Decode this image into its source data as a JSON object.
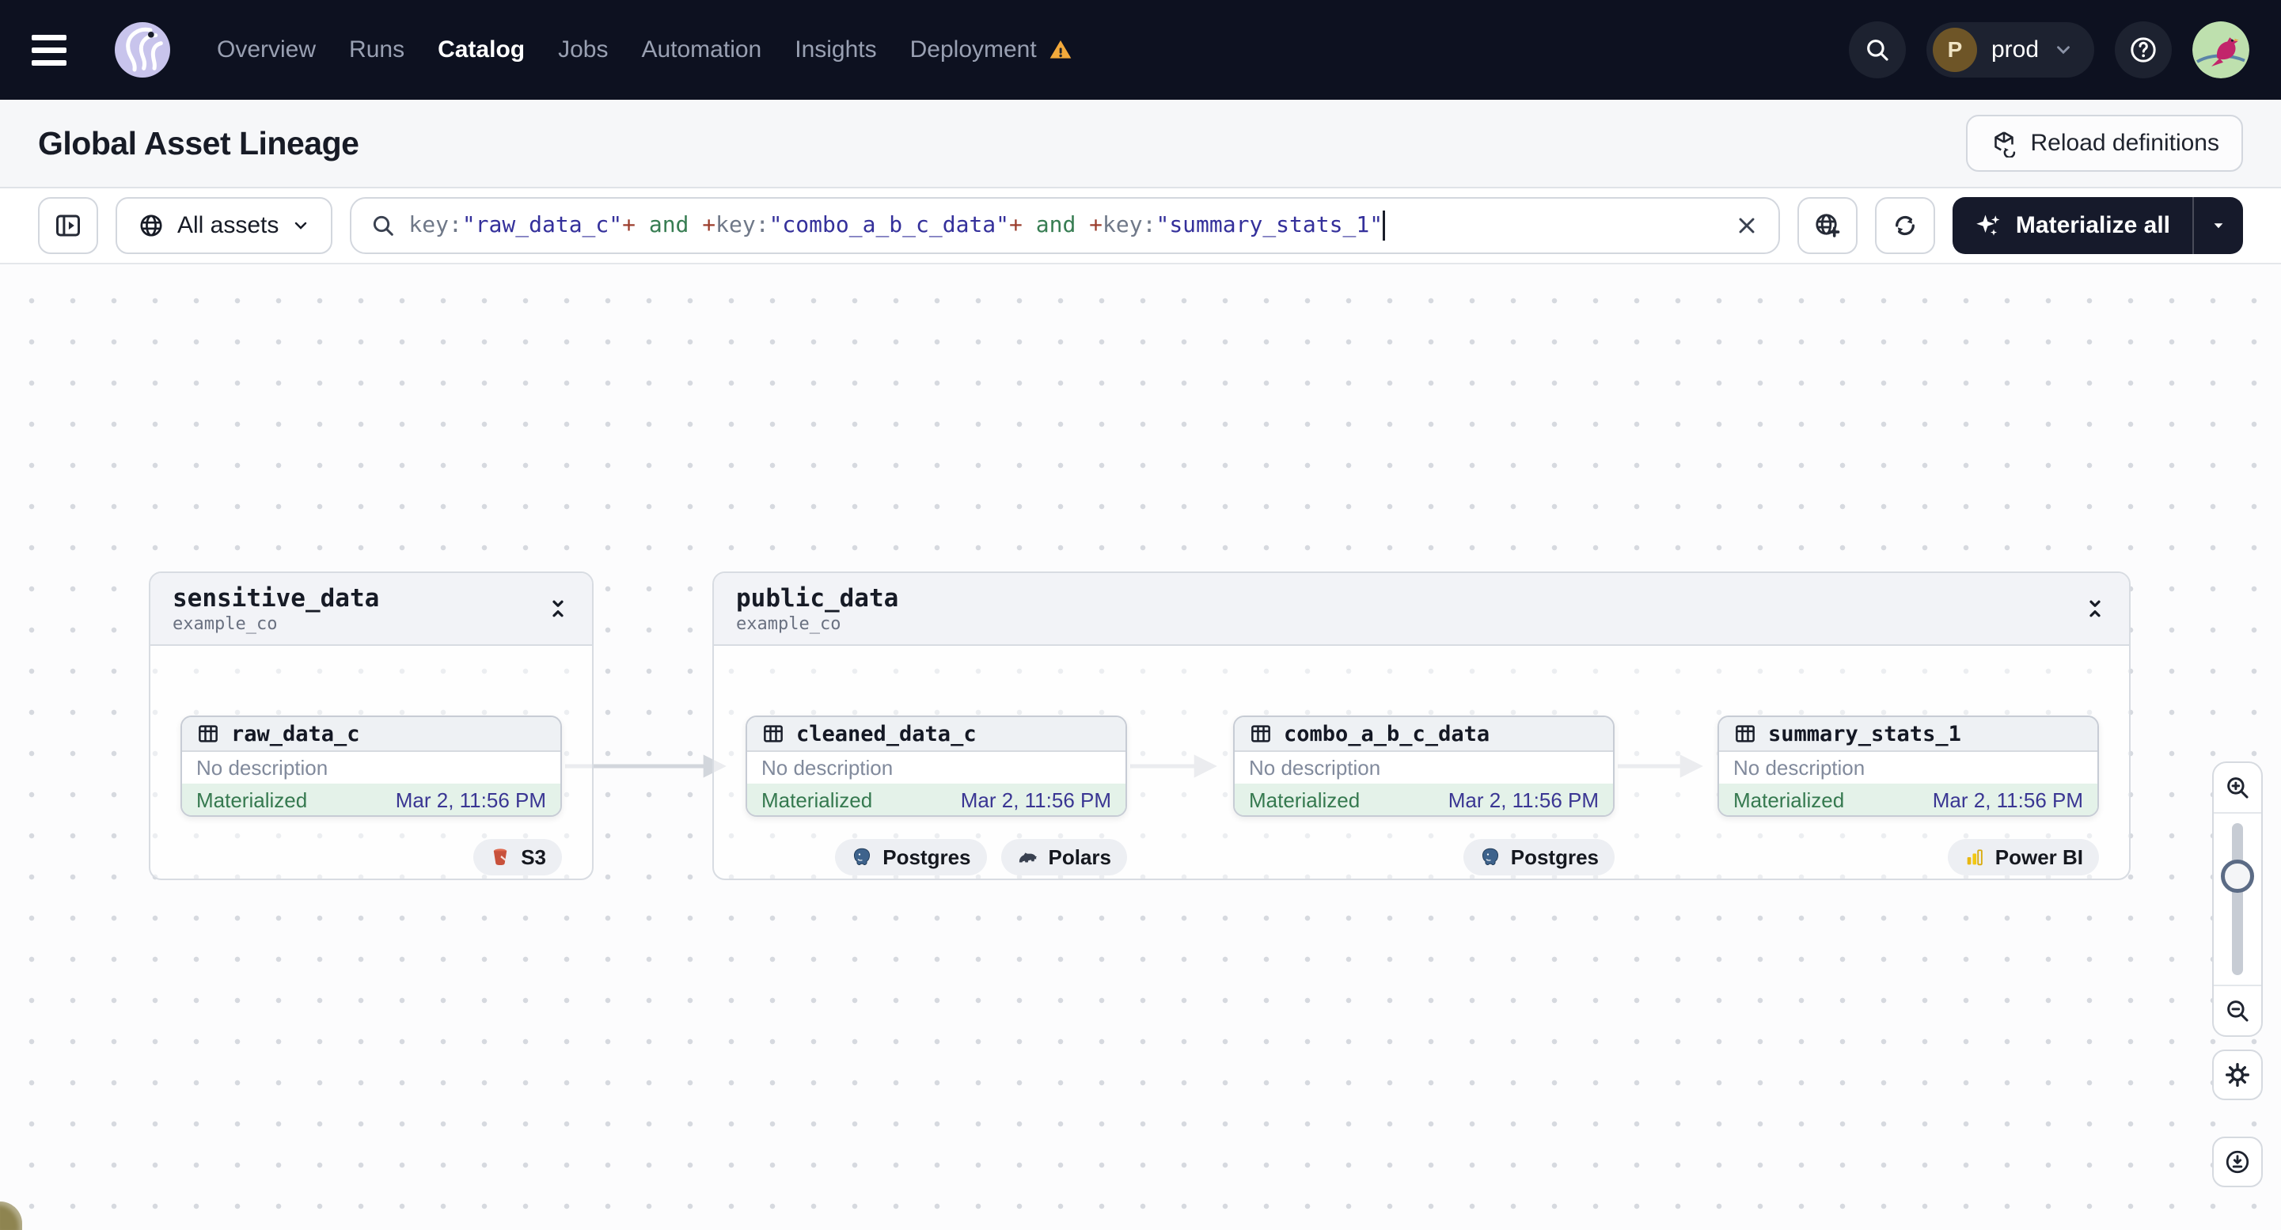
{
  "navbar": {
    "links": [
      {
        "label": "Overview"
      },
      {
        "label": "Runs"
      },
      {
        "label": "Catalog"
      },
      {
        "label": "Jobs"
      },
      {
        "label": "Automation"
      },
      {
        "label": "Insights"
      },
      {
        "label": "Deployment"
      }
    ],
    "env": {
      "initial": "P",
      "name": "prod"
    }
  },
  "page": {
    "title": "Global Asset Lineage",
    "reload_button": "Reload definitions"
  },
  "filter": {
    "scope_label": "All assets",
    "query": {
      "segments": [
        {
          "text": "key:",
          "type": "key"
        },
        {
          "text": "\"raw_data_c\"",
          "type": "str"
        },
        {
          "text": "+",
          "type": "plus"
        },
        {
          "text": " and ",
          "type": "op"
        },
        {
          "text": "+",
          "type": "plus"
        },
        {
          "text": "key:",
          "type": "key"
        },
        {
          "text": "\"combo_a_b_c_data\"",
          "type": "str"
        },
        {
          "text": "+",
          "type": "plus"
        },
        {
          "text": " and ",
          "type": "op"
        },
        {
          "text": "+",
          "type": "plus"
        },
        {
          "text": "key:",
          "type": "key"
        },
        {
          "text": "\"summary_stats_1\"",
          "type": "str"
        }
      ]
    }
  },
  "actions": {
    "materialize_label": "Materialize all"
  },
  "canvas": {
    "groups": [
      {
        "name": "sensitive_data",
        "subtitle": "example_co"
      },
      {
        "name": "public_data",
        "subtitle": "example_co"
      }
    ],
    "nodes": [
      {
        "name": "raw_data_c",
        "description": "No description",
        "status": "Materialized",
        "timestamp": "Mar 2, 11:56 PM",
        "tags": [
          "S3"
        ]
      },
      {
        "name": "cleaned_data_c",
        "description": "No description",
        "status": "Materialized",
        "timestamp": "Mar 2, 11:56 PM",
        "tags": [
          "Postgres",
          "Polars"
        ]
      },
      {
        "name": "combo_a_b_c_data",
        "description": "No description",
        "status": "Materialized",
        "timestamp": "Mar 2, 11:56 PM",
        "tags": [
          "Postgres"
        ]
      },
      {
        "name": "summary_stats_1",
        "description": "No description",
        "status": "Materialized",
        "timestamp": "Mar 2, 11:56 PM",
        "tags": [
          "Power BI"
        ]
      }
    ]
  },
  "colors": {
    "navbar_bg": "#0D1120",
    "warning_orange": "#F2A93B",
    "materialized_green": "#35794F",
    "materialized_bg": "#E4F2E9",
    "timestamp_indigo": "#3A3693",
    "query_string": "#34309B",
    "query_plus": "#9B3D2C",
    "query_and": "#377D52",
    "materialize_btn_bg": "#161A2B"
  }
}
